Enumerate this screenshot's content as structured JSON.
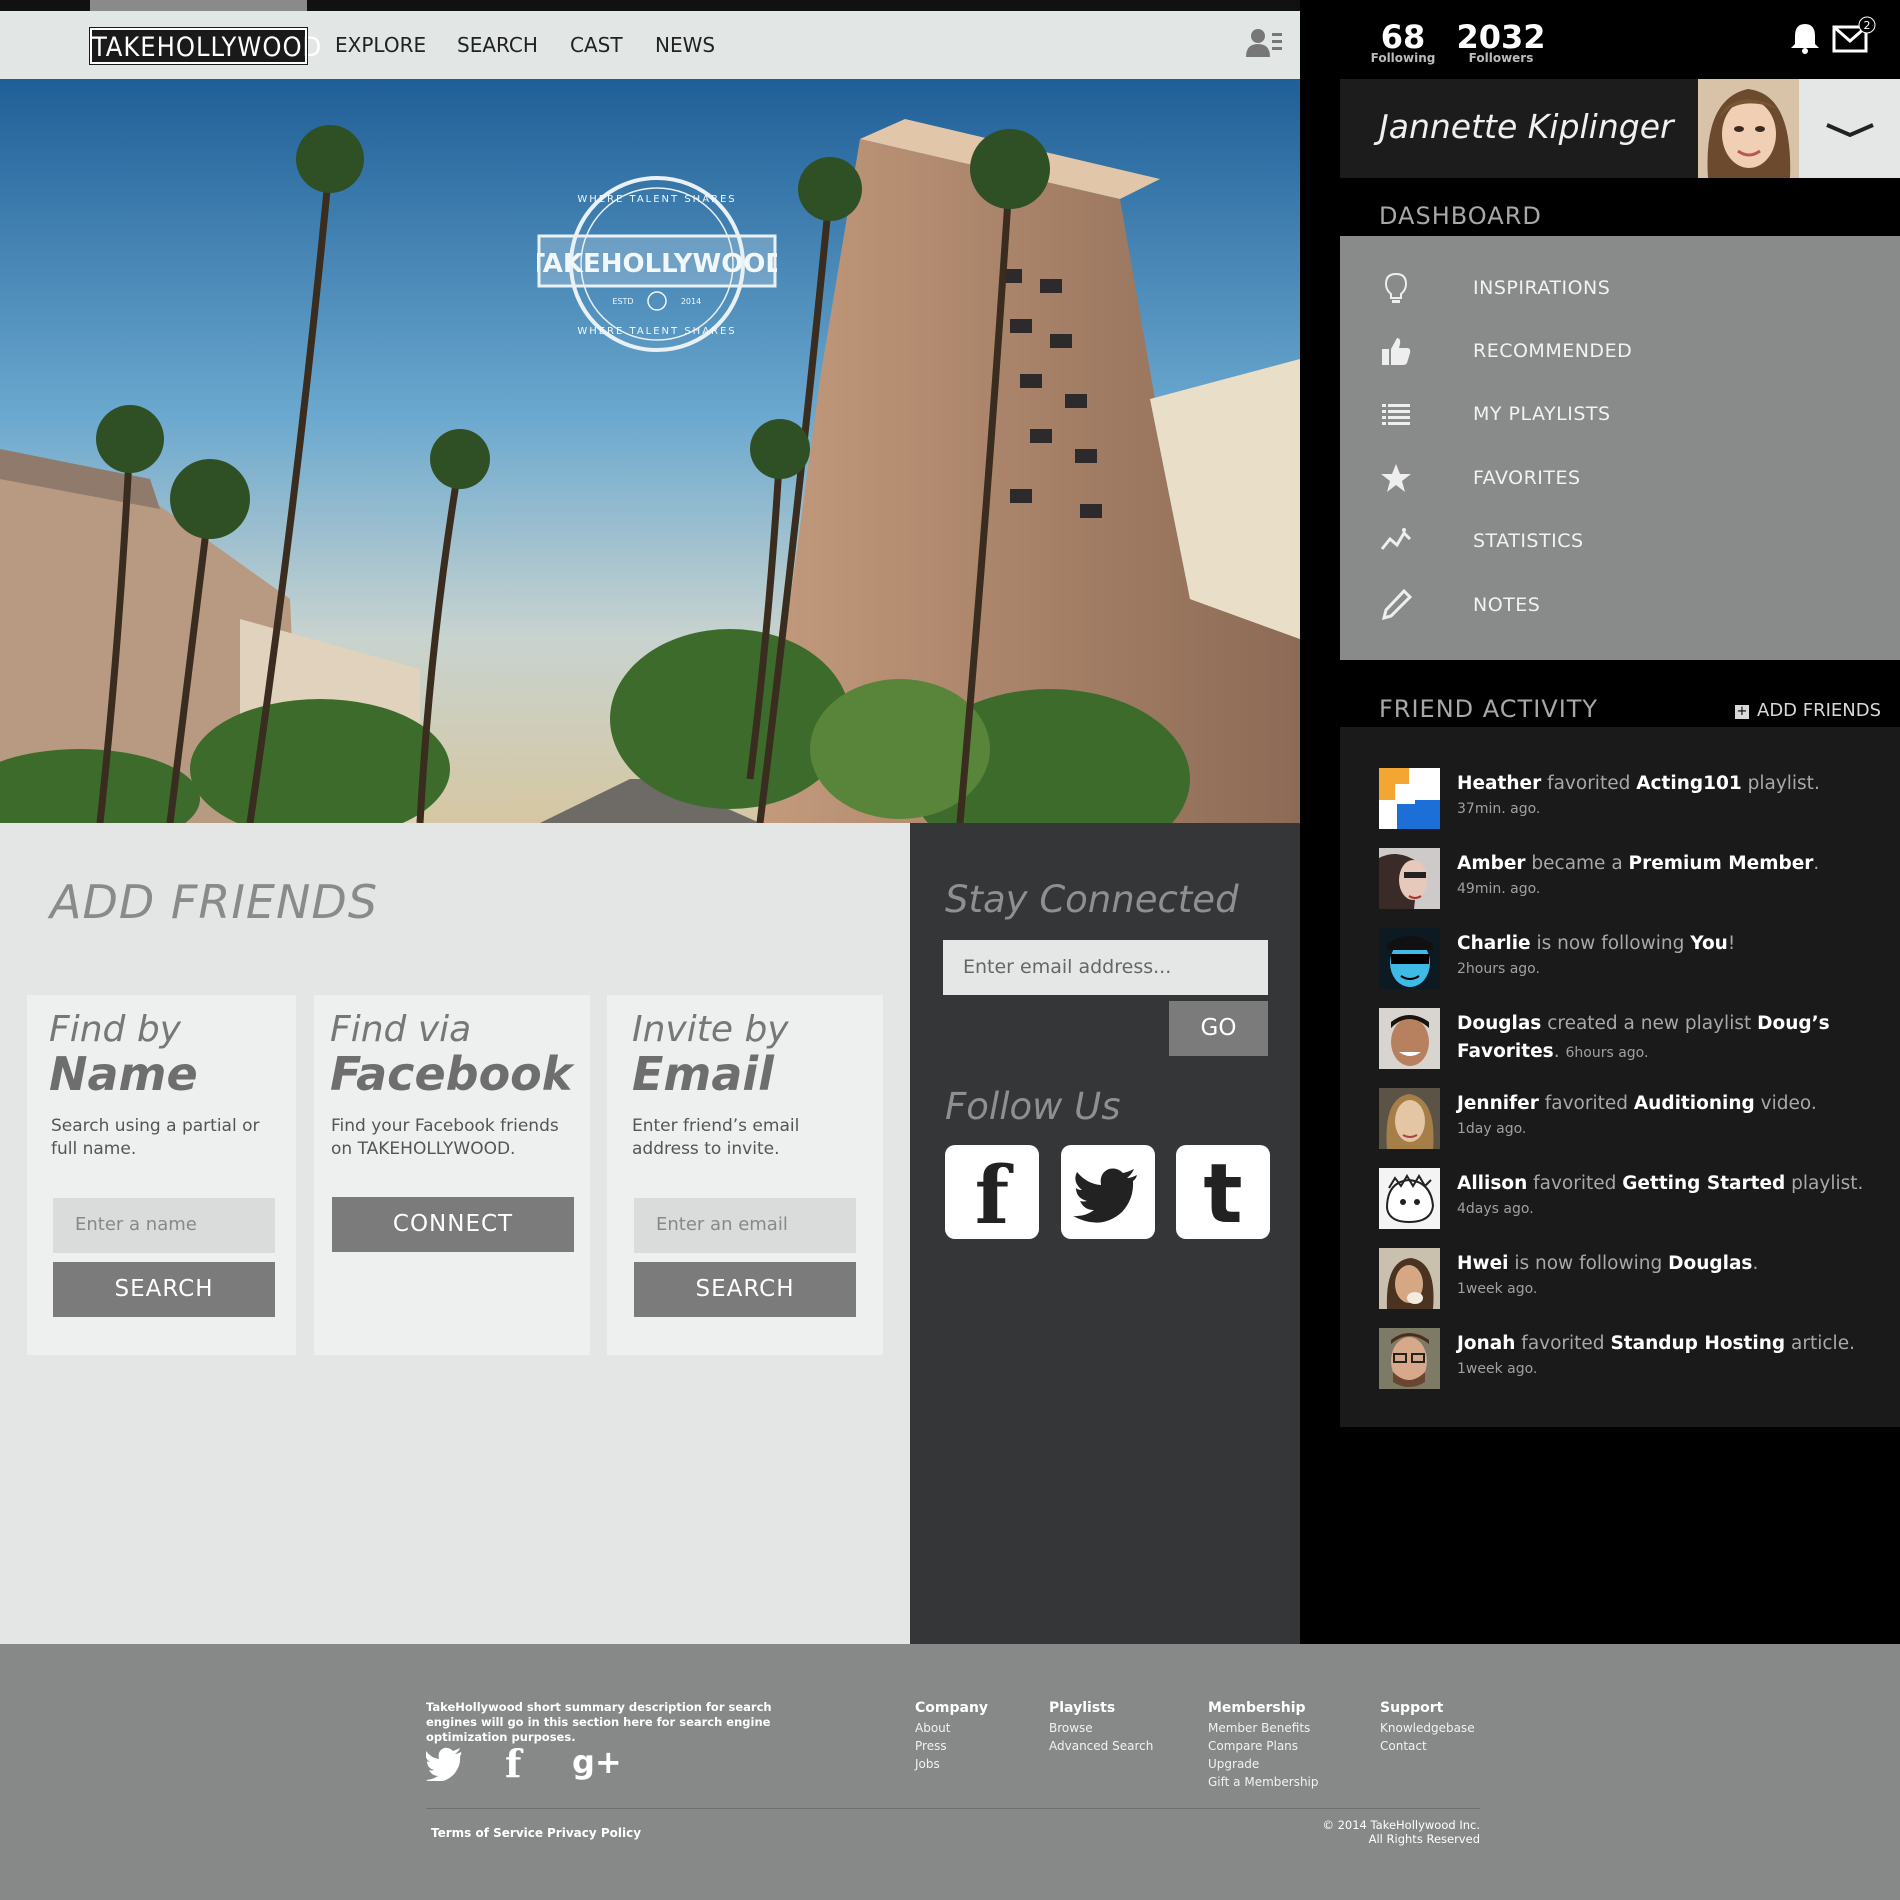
{
  "nav": {
    "logo": "TAKEHOLLYWOOD",
    "links": [
      "EXPLORE",
      "SEARCH",
      "CAST",
      "NEWS"
    ]
  },
  "hero": {
    "badge_top": "WHERE TALENT SHARES",
    "badge_name": "TAKEHOLLYWOOD",
    "badge_est": "ESTD",
    "badge_year": "2014",
    "badge_bottom": "WHERE TALENT SHARES"
  },
  "add_friends": {
    "title": "ADD FRIENDS",
    "cards": [
      {
        "line1": "Find by",
        "line2": "Name",
        "desc": "Search using a partial or full name.",
        "placeholder": "Enter a name",
        "button": "SEARCH"
      },
      {
        "line1": "Find via",
        "line2": "Facebook",
        "desc": "Find your Facebook friends on TAKEHOLLYWOOD.",
        "button": "CONNECT"
      },
      {
        "line1": "Invite by",
        "line2": "Email",
        "desc": "Enter friend’s email address to invite.",
        "placeholder": "Enter an email",
        "button": "SEARCH"
      }
    ]
  },
  "stay_connected": {
    "title": "Stay Connected",
    "placeholder": "Enter email address...",
    "go": "GO",
    "follow_title": "Follow Us"
  },
  "sidebar": {
    "following_count": "68",
    "following_label": "Following",
    "followers_count": "2032",
    "followers_label": "Followers",
    "mail_badge": "2",
    "user_name": "Jannette Kiplinger",
    "dashboard_title": "DASHBOARD",
    "dashboard_items": [
      {
        "label": "INSPIRATIONS",
        "icon": "lightbulb-icon"
      },
      {
        "label": "RECOMMENDED",
        "icon": "thumbs-up-icon"
      },
      {
        "label": "MY PLAYLISTS",
        "icon": "list-icon"
      },
      {
        "label": "FAVORITES",
        "icon": "star-icon"
      },
      {
        "label": "STATISTICS",
        "icon": "chart-line-icon"
      },
      {
        "label": "NOTES",
        "icon": "pencil-icon"
      }
    ],
    "activity_title": "FRIEND ACTIVITY",
    "add_friends_label": "ADD FRIENDS",
    "activity": [
      {
        "name": "Heather",
        "verb": " favorited ",
        "obj": "Acting101",
        "tail": " playlist.",
        "ago": "37min. ago."
      },
      {
        "name": "Amber",
        "verb": " became a ",
        "obj": "Premium Member",
        "tail": ".",
        "ago": "49min. ago."
      },
      {
        "name": "Charlie",
        "verb": " is now following ",
        "obj": "You",
        "tail": "!",
        "ago": "2hours ago."
      },
      {
        "name": "Douglas",
        "verb": " created a new playlist ",
        "obj": "Doug’s Favorites",
        "tail": ".",
        "ago": "6hours ago."
      },
      {
        "name": "Jennifer",
        "verb": " favorited ",
        "obj": "Auditioning",
        "tail": " video.",
        "ago": "1day ago."
      },
      {
        "name": "Allison",
        "verb": " favorited ",
        "obj": "Getting Started",
        "tail": " playlist.",
        "ago": "4days ago."
      },
      {
        "name": "Hwei",
        "verb": " is now following ",
        "obj": "Douglas",
        "tail": ".",
        "ago": "1week ago."
      },
      {
        "name": "Jonah",
        "verb": " favorited ",
        "obj": "Standup Hosting",
        "tail": " article.",
        "ago": "1week ago."
      }
    ]
  },
  "footer": {
    "description": "TakeHollywood short summary description for  search engines will go in this section here for search engine optimization purposes.",
    "columns": [
      {
        "heading": "Company",
        "items": [
          "About",
          "Press",
          "Jobs"
        ]
      },
      {
        "heading": "Playlists",
        "items": [
          "Browse",
          "Advanced Search"
        ]
      },
      {
        "heading": "Membership",
        "items": [
          "Member Benefits",
          "Compare Plans",
          "Upgrade",
          "Gift a Membership"
        ]
      },
      {
        "heading": "Support",
        "items": [
          "Knowledgebase",
          "Contact"
        ]
      }
    ],
    "terms": "Terms of Service",
    "privacy": "Privacy Policy",
    "copyright": "© 2014 TakeHollywood Inc.",
    "rights": "All Rights Reserved"
  }
}
